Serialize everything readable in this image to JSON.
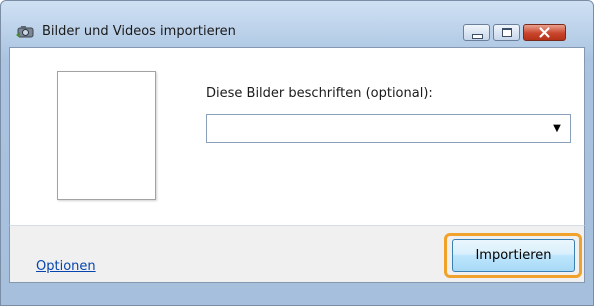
{
  "window": {
    "title": "Bilder und Videos importieren",
    "app_icon": "camera-import-icon",
    "controls": {
      "minimize": "minimize-icon",
      "maximize": "maximize-icon",
      "close": "close-icon"
    }
  },
  "main": {
    "caption_label": "Diese Bilder beschriften (optional):",
    "caption_value": "",
    "caption_placeholder": ""
  },
  "footer": {
    "options_label": "Optionen",
    "import_label": "Importieren"
  },
  "colors": {
    "highlight": "#f0a22a",
    "link": "#0645ad",
    "close_button": "#c9452d"
  }
}
